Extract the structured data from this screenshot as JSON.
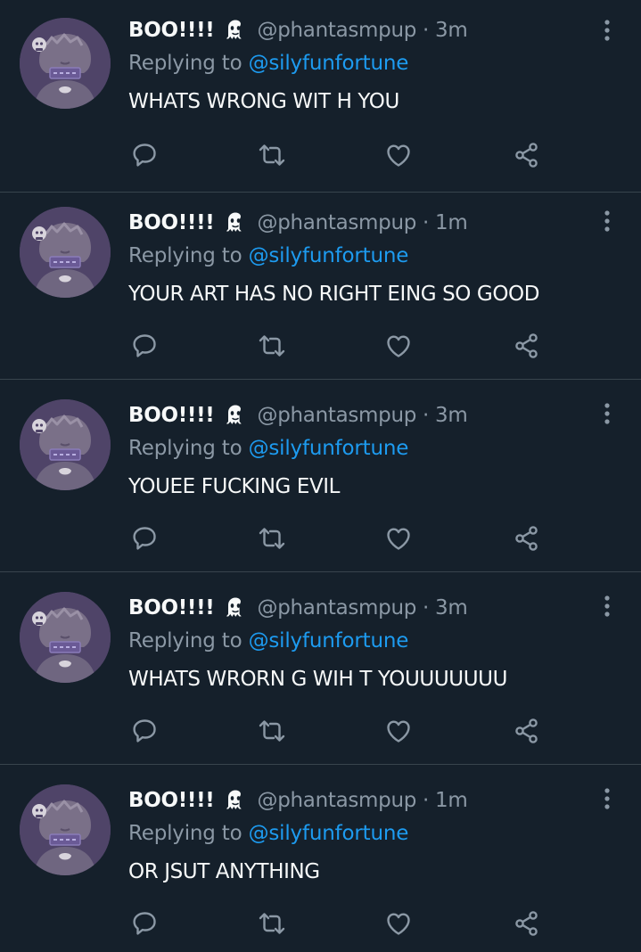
{
  "colors": {
    "background": "#15202b",
    "divider": "#38444d",
    "primary_text": "#f7f9f9",
    "secondary_text": "#8b98a5",
    "mention": "#1d9bf0",
    "avatar_bg": "#4f4468"
  },
  "icons": {
    "badge": "ghost-icon",
    "more": "more-vertical-icon",
    "reply": "reply-icon",
    "retweet": "retweet-icon",
    "like": "heart-icon",
    "share": "share-icon"
  },
  "tweets": [
    {
      "name": "BOO!!!!",
      "handle": "@phantasmpup",
      "separator": "·",
      "time": "3m",
      "replying_prefix": "Replying to",
      "replying_to": "@silyfunfortune",
      "text": "WHATS WRONG WIT H YOU"
    },
    {
      "name": "BOO!!!!",
      "handle": "@phantasmpup",
      "separator": "·",
      "time": "1m",
      "replying_prefix": "Replying to",
      "replying_to": "@silyfunfortune",
      "text": "YOUR ART HAS NO RIGHT EING SO GOOD"
    },
    {
      "name": "BOO!!!!",
      "handle": "@phantasmpup",
      "separator": "·",
      "time": "3m",
      "replying_prefix": "Replying to",
      "replying_to": "@silyfunfortune",
      "text": "YOUEE FUCKING EVIL"
    },
    {
      "name": "BOO!!!!",
      "handle": "@phantasmpup",
      "separator": "·",
      "time": "3m",
      "replying_prefix": "Replying to",
      "replying_to": "@silyfunfortune",
      "text": "WHATS WRORN G WIH T YOUUUUUUU"
    },
    {
      "name": "BOO!!!!",
      "handle": "@phantasmpup",
      "separator": "·",
      "time": "1m",
      "replying_prefix": "Replying to",
      "replying_to": "@silyfunfortune",
      "text": "OR JSUT ANYTHING"
    }
  ]
}
